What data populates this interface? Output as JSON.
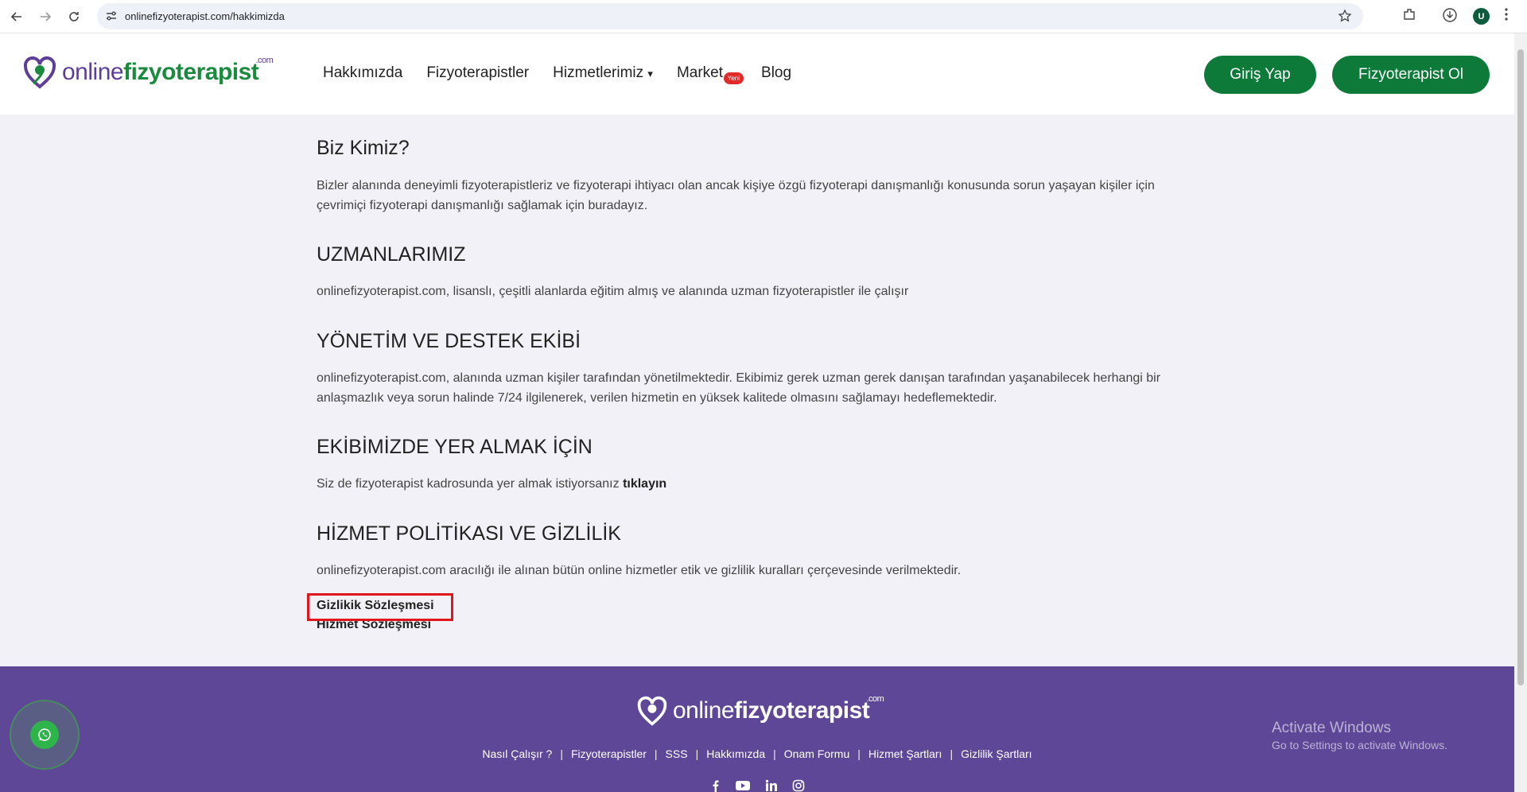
{
  "browser": {
    "url": "onlinefizyoterapist.com/hakkimizda",
    "profile_initial": "U"
  },
  "brand": {
    "logo_part1": "online",
    "logo_part2": "fizyoterapist",
    "logo_suffix": ".com",
    "purple": "#5e3f97",
    "green": "#0d7a3a"
  },
  "nav": {
    "items": [
      "Hakkımızda",
      "Fizyoterapistler",
      "Hizmetlerimiz",
      "Market",
      "Blog"
    ],
    "hizmetler_caret": "▾",
    "market_badge": "Yeni",
    "login_button": "Giriş Yap",
    "join_button": "Fizyoterapist Ol"
  },
  "content": {
    "sections": [
      {
        "heading": "Biz Kimiz?",
        "text": "Bizler alanında deneyimli fizyoterapistleriz ve fizyoterapi ihtiyacı olan ancak kişiye özgü fizyoterapi danışmanlığı konusunda sorun yaşayan kişiler için çevrimiçi fizyoterapi danışmanlığı sağlamak için buradayız."
      },
      {
        "heading": "UZMANLARIMIZ",
        "text": "onlinefizyoterapist.com, lisanslı, çeşitli alanlarda eğitim almış ve alanında uzman fizyoterapistler ile çalışır"
      },
      {
        "heading": "YÖNETİM VE DESTEK EKİBİ",
        "text": "onlinefizyoterapist.com, alanında uzman kişiler tarafından yönetilmektedir. Ekibimiz gerek uzman gerek danışan tarafından yaşanabilecek herhangi bir anlaşmazlık veya sorun halinde 7/24 ilgilenerek, verilen hizmetin en yüksek kalitede olmasını sağlamayı hedeflemektedir."
      },
      {
        "heading": "EKİBİMİZDE YER ALMAK İÇİN",
        "text": "Siz de fizyoterapist kadrosunda yer almak istiyorsanız",
        "link": "tıklayın"
      },
      {
        "heading": "HİZMET POLİTİKASI VE GİZLİLİK",
        "text": "onlinefizyoterapist.com aracılığı ile alınan bütün online hizmetler etik ve gizlilik kuralları çerçevesinde verilmektedir."
      }
    ],
    "privacy_link": "Gizlikik Sözleşmesi",
    "service_link": "Hizmet Sözleşmesi"
  },
  "footer": {
    "links": [
      "Nasıl Çalışır ?",
      "Fizyoterapistler",
      "SSS",
      "Hakkımızda",
      "Onam Formu",
      "Hizmet Şartları",
      "Gizlilik Şartları"
    ],
    "separator": "|",
    "socials": [
      "facebook-icon",
      "youtube-icon",
      "linkedin-icon",
      "instagram-icon"
    ]
  },
  "windows_watermark": {
    "line1": "Activate Windows",
    "line2": "Go to Settings to activate Windows."
  }
}
